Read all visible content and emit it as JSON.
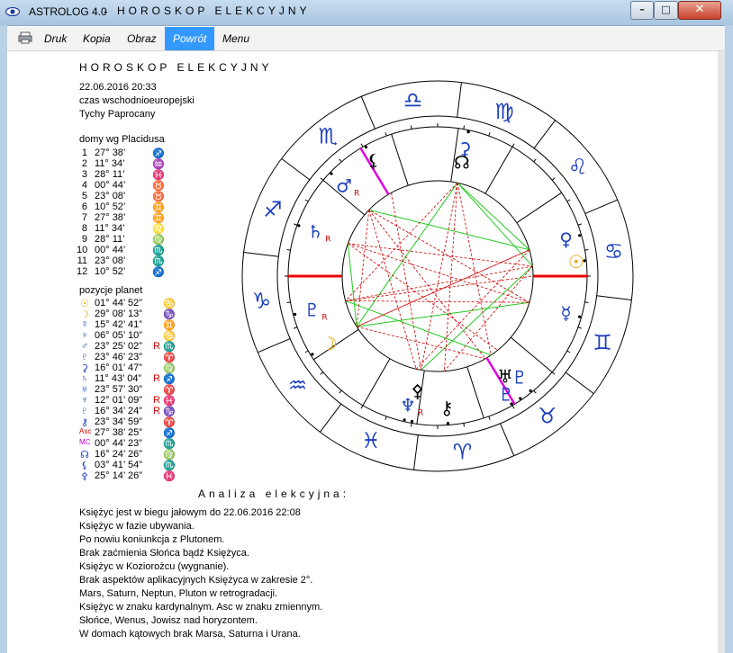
{
  "window": {
    "app_title": "ASTROLOG 4.0",
    "separator": "-",
    "doc_title": "HOROSKOP ELEKCYJNY"
  },
  "menu": [
    {
      "label": "Druk",
      "active": false
    },
    {
      "label": "Kopia",
      "active": false
    },
    {
      "label": "Obraz",
      "active": false
    },
    {
      "label": "Powrót",
      "active": true
    },
    {
      "label": "Menu",
      "active": false
    }
  ],
  "chart": {
    "title": "HOROSKOP ELEKCYJNY",
    "datetime": "22.06.2016  20:33",
    "timezone": "czas wschodnioeuropejski",
    "place": "Tychy Paprocany"
  },
  "houses": {
    "heading": "domy wg Placidusa",
    "rows": [
      {
        "n": "1",
        "pos": "27° 38’",
        "sign": "♐"
      },
      {
        "n": "2",
        "pos": "11° 34’",
        "sign": "♒"
      },
      {
        "n": "3",
        "pos": "28° 11’",
        "sign": "♓"
      },
      {
        "n": "4",
        "pos": "00° 44’",
        "sign": "♉"
      },
      {
        "n": "5",
        "pos": "23° 08’",
        "sign": "♉"
      },
      {
        "n": "6",
        "pos": "10° 52’",
        "sign": "♊"
      },
      {
        "n": "7",
        "pos": "27° 38’",
        "sign": "♊"
      },
      {
        "n": "8",
        "pos": "11° 34’",
        "sign": "♌"
      },
      {
        "n": "9",
        "pos": "28° 11’",
        "sign": "♍"
      },
      {
        "n": "10",
        "pos": "00° 44’",
        "sign": "♏"
      },
      {
        "n": "11",
        "pos": "23° 08’",
        "sign": "♏"
      },
      {
        "n": "12",
        "pos": "10° 52’",
        "sign": "♐"
      }
    ]
  },
  "planets": {
    "heading": "pozycje planet",
    "rows": [
      {
        "glyph": "☉",
        "color": "#e8a000",
        "pos": "01° 44’ 52”",
        "retro": "",
        "sign": "♋"
      },
      {
        "glyph": "☽",
        "color": "#e8a000",
        "pos": "29° 08’ 13”",
        "retro": "",
        "sign": "♑"
      },
      {
        "glyph": "☿",
        "color": "#1c3fbf",
        "pos": "15° 42’ 41”",
        "retro": "",
        "sign": "♊"
      },
      {
        "glyph": "♀",
        "color": "#1c3fbf",
        "pos": "06° 05’ 10”",
        "retro": "",
        "sign": "♋"
      },
      {
        "glyph": "♂",
        "color": "#1c3fbf",
        "pos": "23° 25’ 02”",
        "retro": "R",
        "sign": "♏"
      },
      {
        "glyph": "♇",
        "color": "#1c3fbf",
        "pos": "23° 46’ 23”",
        "retro": "",
        "sign": "♈"
      },
      {
        "glyph": "⚳",
        "color": "#1c3fbf",
        "pos": "16° 01’ 47”",
        "retro": "",
        "sign": "♍"
      },
      {
        "glyph": "♄",
        "color": "#1c3fbf",
        "pos": "11° 43’ 04”",
        "retro": "R",
        "sign": "♐"
      },
      {
        "glyph": "♅",
        "color": "#1c3fbf",
        "pos": "23° 57’ 30”",
        "retro": "",
        "sign": "♈"
      },
      {
        "glyph": "♆",
        "color": "#1c3fbf",
        "pos": "12° 01’ 09”",
        "retro": "R",
        "sign": "♓"
      },
      {
        "glyph": "♇",
        "color": "#1c3fbf",
        "pos": "16° 34’ 24”",
        "retro": "R",
        "sign": "♑"
      },
      {
        "glyph": "⚷",
        "color": "#1c3fbf",
        "pos": "23° 34’ 59”",
        "retro": "",
        "sign": "♈"
      },
      {
        "glyph": "Asc",
        "color": "#d00000",
        "pos": "27° 38’ 25”",
        "retro": "",
        "sign": "♐"
      },
      {
        "glyph": "MC",
        "color": "#d000d0",
        "pos": "00° 44’ 23”",
        "retro": "",
        "sign": "♏"
      },
      {
        "glyph": "☊",
        "color": "#1c3fbf",
        "pos": "16° 24’ 26”",
        "retro": "",
        "sign": "♍"
      },
      {
        "glyph": "⚸",
        "color": "#1c3fbf",
        "pos": "03° 41’ 54”",
        "retro": "",
        "sign": "♏"
      },
      {
        "glyph": "⚴",
        "color": "#1c3fbf",
        "pos": "25° 14’ 26”",
        "retro": "",
        "sign": "♓"
      }
    ]
  },
  "wheel": {
    "signs": [
      {
        "glyph": "♎",
        "angle": 98
      },
      {
        "glyph": "♍",
        "angle": 68
      },
      {
        "glyph": "♌",
        "angle": 38
      },
      {
        "glyph": "♋",
        "angle": 8
      },
      {
        "glyph": "♊",
        "angle": -22
      },
      {
        "glyph": "♉",
        "angle": -52
      },
      {
        "glyph": "♈",
        "angle": -82
      },
      {
        "glyph": "♓",
        "angle": -112
      },
      {
        "glyph": "♒",
        "angle": -142
      },
      {
        "glyph": "♑",
        "angle": -172
      },
      {
        "glyph": "♐",
        "angle": 158
      },
      {
        "glyph": "♏",
        "angle": 128
      }
    ],
    "planet_marks": [
      {
        "glyph": "⚳",
        "color": "#1c3fbf",
        "angle": 78,
        "r": 0.72,
        "retro": ""
      },
      {
        "glyph": "☊",
        "color": "#000000",
        "angle": 78,
        "r": 0.6,
        "retro": ""
      },
      {
        "glyph": "⚸",
        "color": "#000000",
        "angle": 119,
        "r": 0.74,
        "retro": ""
      },
      {
        "glyph": "♂",
        "color": "#1c3fbf",
        "angle": 136,
        "r": 0.72,
        "retro": "R"
      },
      {
        "glyph": "♄",
        "color": "#1c3fbf",
        "angle": 160,
        "r": 0.72,
        "retro": "R"
      },
      {
        "glyph": "♀",
        "color": "#1c3fbf",
        "angle": 16,
        "r": 0.75,
        "retro": ""
      },
      {
        "glyph": "☉",
        "color": "#e8a000",
        "angle": 6,
        "r": 0.8,
        "retro": ""
      },
      {
        "glyph": "☿",
        "color": "#1c3fbf",
        "angle": -16,
        "r": 0.75,
        "retro": ""
      },
      {
        "glyph": "♇",
        "color": "#1c3fbf",
        "angle": 195,
        "r": 0.72,
        "retro": "R"
      },
      {
        "glyph": "☽",
        "color": "#e8a000",
        "angle": 212,
        "r": 0.7,
        "retro": ""
      },
      {
        "glyph": "⚴",
        "color": "#000000",
        "angle": -100,
        "r": 0.6,
        "retro": ""
      },
      {
        "glyph": "♆",
        "color": "#1c3fbf",
        "angle": -103,
        "r": 0.74,
        "retro": "R"
      },
      {
        "glyph": "⚷",
        "color": "#000000",
        "angle": -86,
        "r": 0.74,
        "retro": ""
      },
      {
        "glyph": "♅",
        "color": "#000000",
        "angle": -56,
        "r": 0.64,
        "retro": ""
      },
      {
        "glyph": "♇",
        "color": "#1c3fbf",
        "angle": -51,
        "r": 0.72,
        "retro": ""
      },
      {
        "glyph": "♇",
        "color": "#1c3fbf",
        "angle": -60,
        "r": 0.78,
        "retro": ""
      }
    ]
  },
  "analysis": {
    "heading": "Analiza elekcyjna:",
    "lines": [
      "Księżyc jest w biegu jałowym do 22.06.2016  22:08",
      "Księżyc w fazie ubywania.",
      "Po nowiu koniunkcja z Plutonem.",
      "Brak zaćmienia Słońca bądź Księżyca.",
      "Księżyc w Koziorożcu (wygnanie).",
      "Brak aspektów aplikacyjnych Księżyca w zakresie 2°.",
      "Mars, Saturn, Neptun, Pluton w retrogradacji.",
      "Księżyc w znaku kardynalnym. Asc w znaku zmiennym.",
      "Słońce, Wenus, Jowisz nad horyzontem.",
      "W domach kątowych brak Marsa, Saturna i Urana."
    ]
  },
  "colors": {
    "sign_blue": "#1c3fbf",
    "asc_line": "#e80000",
    "mc_line": "#e000e0",
    "aspect_red": "#d00000",
    "aspect_green": "#22cc22"
  }
}
